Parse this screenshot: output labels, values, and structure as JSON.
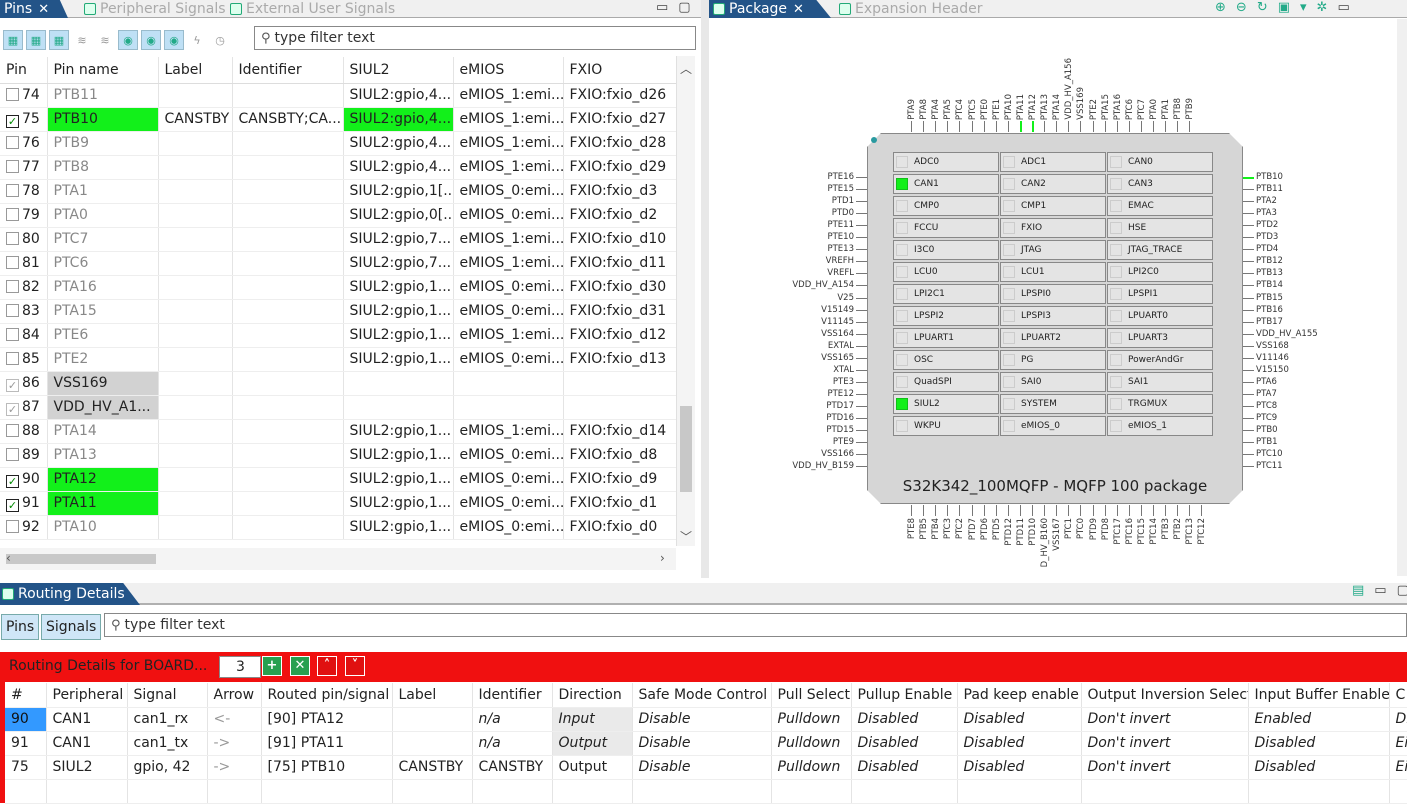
{
  "pins_tabs": [
    {
      "label": "Pins",
      "active": true
    },
    {
      "label": "Peripheral Signals"
    },
    {
      "label": "External User Signals"
    }
  ],
  "pins_filter": "type filter text",
  "pins_headers": [
    "Pin",
    "Pin name",
    "Label",
    "Identifier",
    "SIUL2",
    "eMIOS",
    "FXIO"
  ],
  "pins_rows": [
    {
      "pin": "74",
      "name": "PTB11",
      "label": "",
      "ident": "",
      "siul": "SIUL2:gpio,4...",
      "emios": "eMIOS_1:emi...",
      "fxio": "FXIO:fxio_d26",
      "check": "off",
      "style": ""
    },
    {
      "pin": "75",
      "name": "PTB10",
      "label": "CANSTBY",
      "ident": "CANSBTY;CA...",
      "siul": "SIUL2:gpio,4...",
      "emios": "eMIOS_1:emi...",
      "fxio": "FXIO:fxio_d27",
      "check": "on",
      "style": "green"
    },
    {
      "pin": "76",
      "name": "PTB9",
      "label": "",
      "ident": "",
      "siul": "SIUL2:gpio,4...",
      "emios": "eMIOS_1:emi...",
      "fxio": "FXIO:fxio_d28",
      "check": "off",
      "style": ""
    },
    {
      "pin": "77",
      "name": "PTB8",
      "label": "",
      "ident": "",
      "siul": "SIUL2:gpio,4...",
      "emios": "eMIOS_1:emi...",
      "fxio": "FXIO:fxio_d29",
      "check": "off",
      "style": ""
    },
    {
      "pin": "78",
      "name": "PTA1",
      "label": "",
      "ident": "",
      "siul": "SIUL2:gpio,1[...",
      "emios": "eMIOS_0:emi...",
      "fxio": "FXIO:fxio_d3",
      "check": "off",
      "style": ""
    },
    {
      "pin": "79",
      "name": "PTA0",
      "label": "",
      "ident": "",
      "siul": "SIUL2:gpio,0[...",
      "emios": "eMIOS_0:emi...",
      "fxio": "FXIO:fxio_d2",
      "check": "off",
      "style": ""
    },
    {
      "pin": "80",
      "name": "PTC7",
      "label": "",
      "ident": "",
      "siul": "SIUL2:gpio,7...",
      "emios": "eMIOS_1:emi...",
      "fxio": "FXIO:fxio_d10",
      "check": "off",
      "style": ""
    },
    {
      "pin": "81",
      "name": "PTC6",
      "label": "",
      "ident": "",
      "siul": "SIUL2:gpio,7...",
      "emios": "eMIOS_1:emi...",
      "fxio": "FXIO:fxio_d11",
      "check": "off",
      "style": ""
    },
    {
      "pin": "82",
      "name": "PTA16",
      "label": "",
      "ident": "",
      "siul": "SIUL2:gpio,1...",
      "emios": "eMIOS_0:emi...",
      "fxio": "FXIO:fxio_d30",
      "check": "off",
      "style": ""
    },
    {
      "pin": "83",
      "name": "PTA15",
      "label": "",
      "ident": "",
      "siul": "SIUL2:gpio,1...",
      "emios": "eMIOS_0:emi...",
      "fxio": "FXIO:fxio_d31",
      "check": "off",
      "style": ""
    },
    {
      "pin": "84",
      "name": "PTE6",
      "label": "",
      "ident": "",
      "siul": "SIUL2:gpio,1...",
      "emios": "eMIOS_1:emi...",
      "fxio": "FXIO:fxio_d12",
      "check": "off",
      "style": ""
    },
    {
      "pin": "85",
      "name": "PTE2",
      "label": "",
      "ident": "",
      "siul": "SIUL2:gpio,1...",
      "emios": "eMIOS_0:emi...",
      "fxio": "FXIO:fxio_d13",
      "check": "off",
      "style": ""
    },
    {
      "pin": "86",
      "name": "VSS169",
      "label": "",
      "ident": "",
      "siul": "",
      "emios": "",
      "fxio": "",
      "check": "locked",
      "style": "gray"
    },
    {
      "pin": "87",
      "name": "VDD_HV_A1...",
      "label": "",
      "ident": "",
      "siul": "",
      "emios": "",
      "fxio": "",
      "check": "locked",
      "style": "gray"
    },
    {
      "pin": "88",
      "name": "PTA14",
      "label": "",
      "ident": "",
      "siul": "SIUL2:gpio,1...",
      "emios": "eMIOS_1:emi...",
      "fxio": "FXIO:fxio_d14",
      "check": "off",
      "style": ""
    },
    {
      "pin": "89",
      "name": "PTA13",
      "label": "",
      "ident": "",
      "siul": "SIUL2:gpio,1...",
      "emios": "eMIOS_0:emi...",
      "fxio": "FXIO:fxio_d8",
      "check": "off",
      "style": ""
    },
    {
      "pin": "90",
      "name": "PTA12",
      "label": "",
      "ident": "",
      "siul": "SIUL2:gpio,1...",
      "emios": "eMIOS_0:emi...",
      "fxio": "FXIO:fxio_d9",
      "check": "on",
      "style": "green"
    },
    {
      "pin": "91",
      "name": "PTA11",
      "label": "",
      "ident": "",
      "siul": "SIUL2:gpio,1...",
      "emios": "eMIOS_0:emi...",
      "fxio": "FXIO:fxio_d1",
      "check": "on",
      "style": "green"
    },
    {
      "pin": "92",
      "name": "PTA10",
      "label": "",
      "ident": "",
      "siul": "SIUL2:gpio,1...",
      "emios": "eMIOS_0:emi...",
      "fxio": "FXIO:fxio_d0",
      "check": "off",
      "style": ""
    }
  ],
  "pkg_tabs": [
    {
      "label": "Package",
      "active": true
    },
    {
      "label": "Expansion Header"
    }
  ],
  "chip_title": "S32K342_100MQFP - MQFP 100 package",
  "peripherals": [
    {
      "name": "ADC0",
      "on": false
    },
    {
      "name": "ADC1",
      "on": false
    },
    {
      "name": "CAN0",
      "on": false
    },
    {
      "name": "CAN1",
      "on": true
    },
    {
      "name": "CAN2",
      "on": false
    },
    {
      "name": "CAN3",
      "on": false
    },
    {
      "name": "CMP0",
      "on": false
    },
    {
      "name": "CMP1",
      "on": false
    },
    {
      "name": "EMAC",
      "on": false
    },
    {
      "name": "FCCU",
      "on": false
    },
    {
      "name": "FXIO",
      "on": false
    },
    {
      "name": "HSE",
      "on": false
    },
    {
      "name": "I3C0",
      "on": false
    },
    {
      "name": "JTAG",
      "on": false
    },
    {
      "name": "JTAG_TRACE",
      "on": false
    },
    {
      "name": "LCU0",
      "on": false
    },
    {
      "name": "LCU1",
      "on": false
    },
    {
      "name": "LPI2C0",
      "on": false
    },
    {
      "name": "LPI2C1",
      "on": false
    },
    {
      "name": "LPSPI0",
      "on": false
    },
    {
      "name": "LPSPI1",
      "on": false
    },
    {
      "name": "LPSPI2",
      "on": false
    },
    {
      "name": "LPSPI3",
      "on": false
    },
    {
      "name": "LPUART0",
      "on": false
    },
    {
      "name": "LPUART1",
      "on": false
    },
    {
      "name": "LPUART2",
      "on": false
    },
    {
      "name": "LPUART3",
      "on": false
    },
    {
      "name": "OSC",
      "on": false
    },
    {
      "name": "PG",
      "on": false
    },
    {
      "name": "PowerAndGr",
      "on": false
    },
    {
      "name": "QuadSPI",
      "on": false
    },
    {
      "name": "SAI0",
      "on": false
    },
    {
      "name": "SAI1",
      "on": false
    },
    {
      "name": "SIUL2",
      "on": true
    },
    {
      "name": "SYSTEM",
      "on": false
    },
    {
      "name": "TRGMUX",
      "on": false
    },
    {
      "name": "WKPU",
      "on": false
    },
    {
      "name": "eMIOS_0",
      "on": false
    },
    {
      "name": "eMIOS_1",
      "on": false
    }
  ],
  "left_pins": [
    "PTE16",
    "PTE15",
    "PTD1",
    "PTD0",
    "PTE11",
    "PTE10",
    "PTE13",
    "VREFH",
    "VREFL",
    "VDD_HV_A154",
    "V25",
    "V15149",
    "V11145",
    "VSS164",
    "EXTAL",
    "VSS165",
    "XTAL",
    "PTE3",
    "PTE12",
    "PTD17",
    "PTD16",
    "PTD15",
    "PTE9",
    "VSS166",
    "VDD_HV_B159"
  ],
  "right_pins": [
    "PTB10",
    "PTB11",
    "PTA2",
    "PTA3",
    "PTD2",
    "PTD3",
    "PTD4",
    "PTB12",
    "PTB13",
    "PTB14",
    "PTB15",
    "PTB16",
    "PTB17",
    "VDD_HV_A155",
    "VSS168",
    "V11146",
    "V15150",
    "PTA6",
    "PTA7",
    "PTC8",
    "PTC9",
    "PTB0",
    "PTB1",
    "PTC10",
    "PTC11"
  ],
  "top_pins": [
    "PTA9",
    "PTA8",
    "PTA4",
    "PTA5",
    "PTC4",
    "PTC5",
    "PTE0",
    "PTE1",
    "PTA10",
    "PTA11",
    "PTA12",
    "PTA13",
    "PTA14",
    "VDD_HV_A156",
    "VSS169",
    "PTE2",
    "PTA15",
    "PTA16",
    "PTC6",
    "PTC7",
    "PTA0",
    "PTA1",
    "PTB8",
    "PTB9"
  ],
  "bottom_pins": [
    "PTE8",
    "PTB5",
    "PTB4",
    "PTC3",
    "PTC2",
    "PTD7",
    "PTD6",
    "PTD5",
    "PTD12",
    "PTD11",
    "PTD10",
    "D_HV_B160",
    "VSS167",
    "PTC1",
    "PTC0",
    "PTD9",
    "PTD8",
    "PTC17",
    "PTC16",
    "PTC15",
    "PTC14",
    "PTB3",
    "PTB2",
    "PTC13",
    "PTC12"
  ],
  "routing": {
    "tab": "Routing Details",
    "seg_pins": "Pins",
    "seg_signals": "Signals",
    "filter": "type filter text",
    "title": "Routing Details for BOARD...",
    "count": "3",
    "headers": [
      "#",
      "Peripheral",
      "Signal",
      "Arrow",
      "Routed pin/signal",
      "Label",
      "Identifier",
      "Direction",
      "Safe Mode Control",
      "Pull Select",
      "Pullup Enable",
      "Pad keep enable",
      "Output Inversion Select",
      "Input Buffer Enable",
      "C"
    ],
    "rows": [
      {
        "num": "90",
        "per": "CAN1",
        "sig": "can1_rx",
        "arrow": "<-",
        "pin": "[90] PTA12",
        "label": "",
        "ident": "n/a",
        "dir": "Input",
        "safe": "Disable",
        "pull": "Pulldown",
        "pullup": "Disabled",
        "pad": "Disabled",
        "inv": "Don't invert",
        "ibe": "Enabled",
        "c": "Di"
      },
      {
        "num": "91",
        "per": "CAN1",
        "sig": "can1_tx",
        "arrow": "->",
        "pin": "[91] PTA11",
        "label": "",
        "ident": "n/a",
        "dir": "Output",
        "safe": "Disable",
        "pull": "Pulldown",
        "pullup": "Disabled",
        "pad": "Disabled",
        "inv": "Don't invert",
        "ibe": "Disabled",
        "c": "Ei"
      },
      {
        "num": "75",
        "per": "SIUL2",
        "sig": "gpio, 42",
        "arrow": "->",
        "pin": "[75] PTB10",
        "label": "CANSTBY",
        "ident": "CANSTBY",
        "dir": "Output",
        "safe": "Disable",
        "pull": "Pulldown",
        "pullup": "Disabled",
        "pad": "Disabled",
        "inv": "Don't invert",
        "ibe": "Disabled",
        "c": "Ei"
      }
    ]
  }
}
